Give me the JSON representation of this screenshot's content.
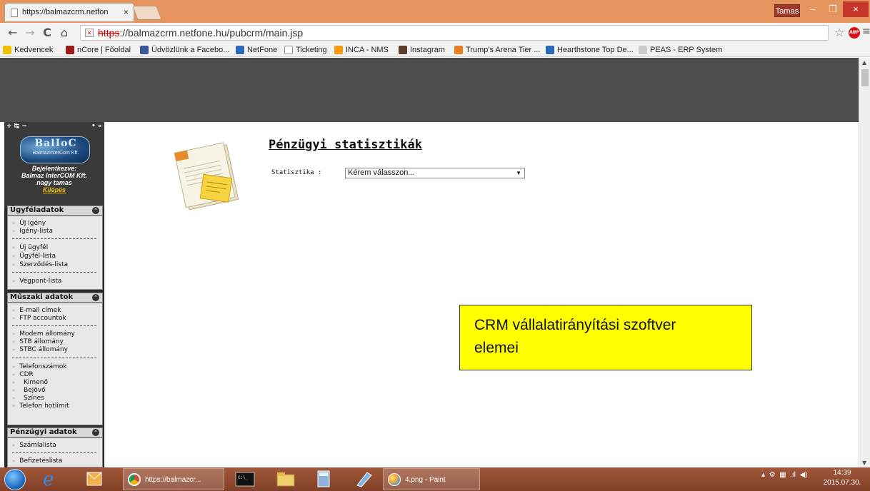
{
  "browser": {
    "tab_title": "https://balmazcrm.netfon",
    "tab_close": "×",
    "user_badge": "Tamas",
    "win_min": "–",
    "win_max": "❐",
    "win_close": "×",
    "url_scheme": "https",
    "url_rest": "://balmazcrm.netfone.hu/pubcrm/main.jsp",
    "icons": {
      "back": "←",
      "forward": "→",
      "reload": "C",
      "home": "⌂",
      "star": "☆",
      "abp": "ABP",
      "menu": "≡"
    }
  },
  "bookmarks": [
    {
      "label": "Kedvencek",
      "color": "#f0c000"
    },
    {
      "label": "nCore | Főoldal",
      "color": "#9b1b1b"
    },
    {
      "label": "Üdvözlünk a Facebo...",
      "color": "#3b5998"
    },
    {
      "label": "NetFone",
      "color": "#2a6ab8"
    },
    {
      "label": "Ticketing",
      "color": "#bbbbbb"
    },
    {
      "label": "INCA - NMS",
      "color": "#f39c12"
    },
    {
      "label": "Instagram",
      "color": "#5a3d2b"
    },
    {
      "label": "Trump's Arena Tier ...",
      "color": "#e67e22"
    },
    {
      "label": "Hearthstone Top De...",
      "color": "#2a6ab8"
    },
    {
      "label": "PEAS - ERP System",
      "color": "#888888"
    }
  ],
  "sidebar": {
    "controls_left": "+ ↹ −",
    "controls_right": "• «",
    "logo_text": "BalIoC",
    "logo_sub": "BalmazInterCom Kft.",
    "login_label": "Bejelentkezve:",
    "company": "Balmaz InterCOM Kft.",
    "user": "nagy tamas",
    "logout": "Kilépés",
    "sections": [
      {
        "title": "Ügyféladatok",
        "items": [
          "Új igény",
          "Igény-lista",
          "Új ügyfél",
          "Ügyfél-lista",
          "Szerződés-lista",
          "Végpont-lista"
        ]
      },
      {
        "title": "Műszaki adatok",
        "items": [
          "E-mail címek",
          "FTP accountok",
          "Modem állomány",
          "STB állomány",
          "STBC állomány",
          "Telefonszámok",
          "CDR",
          "Kimenő",
          "Bejövő",
          "Színes",
          "Telefon hotlimit"
        ]
      },
      {
        "title": "Pénzügyi adatok",
        "items": [
          "Számlalista",
          "Befizetéslista"
        ]
      }
    ]
  },
  "main": {
    "title": "Pénzügyi statisztikák",
    "stat_label": "Statisztika :",
    "select_value": "Kérem válasszon...",
    "callout_line1": "CRM vállalatirányítási szoftver",
    "callout_line2": "elemei"
  },
  "taskbar": {
    "chrome_window": "https://balmazcr...",
    "paint_window": "4.png - Paint",
    "time": "14:39",
    "date": "2015.07.30."
  },
  "colors": {
    "titlebar": "#e4945c",
    "header_dark": "#4d4d4d",
    "callout": "#ffff00",
    "taskbar": "#8f4a30"
  }
}
